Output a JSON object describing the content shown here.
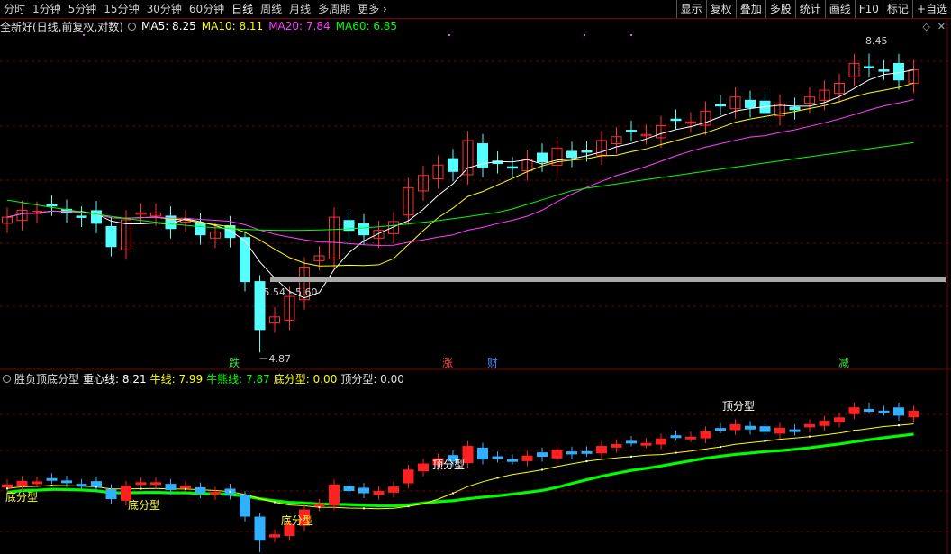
{
  "toolbar": {
    "periods": [
      "分时",
      "1分钟",
      "5分钟",
      "15分钟",
      "30分钟",
      "60分钟",
      "日线",
      "周线",
      "月线",
      "多周期",
      "更多"
    ],
    "active_period": "日线",
    "buttons": [
      "显示",
      "复权",
      "叠加",
      "多股",
      "统计",
      "画线",
      "F10",
      "标记",
      "+自选"
    ]
  },
  "main": {
    "title": "全新好(日线,前复权,对数)",
    "ma5_label": "MA5: 8.25",
    "ma10_label": "MA10: 8.11",
    "ma20_label": "MA20: 7.84",
    "ma60_label": "MA60: 6.85",
    "high_label": "8.45",
    "low_label": "4.87",
    "range_label": "5.54 - 5.60",
    "marks": [
      {
        "text": "跌",
        "color": "#40e040"
      },
      {
        "text": "涨",
        "color": "#ff4040"
      },
      {
        "text": "财",
        "color": "#4080ff"
      },
      {
        "text": "减",
        "color": "#40e040"
      }
    ]
  },
  "sub": {
    "title": "胜负顶底分型",
    "center_label": "重心线: 8.21",
    "bull_label": "牛线: 7.99",
    "bullbear_label": "牛熊线: 7.87",
    "bottom_label": "底分型: 0.00",
    "top_label": "顶分型: 0.00",
    "annotations": [
      "底分型",
      "底分型",
      "底分型",
      "顶分型",
      "顶分型"
    ]
  },
  "colors": {
    "ma5": "#ffffff",
    "ma10": "#ffff00",
    "ma20": "#ff40ff",
    "ma60": "#00ff00",
    "up": "#ff3030",
    "down": "#54ffff",
    "grid": "#7a0000"
  },
  "chart_data": {
    "type": "candlestick",
    "closes": [
      6.25,
      6.33,
      6.32,
      6.38,
      6.3,
      6.25,
      6.18,
      5.92,
      6.22,
      6.3,
      6.3,
      6.12,
      6.22,
      6.05,
      6.08,
      6.02,
      5.55,
      5.08,
      5.2,
      5.4,
      5.7,
      5.82,
      6.25,
      6.1,
      6.05,
      6.1,
      6.2,
      6.6,
      6.75,
      6.88,
      6.8,
      7.2,
      6.85,
      6.9,
      6.85,
      6.95,
      6.92,
      7.1,
      6.98,
      7.05,
      7.2,
      7.25,
      7.32,
      7.28,
      7.4,
      7.48,
      7.45,
      7.6,
      7.68,
      7.8,
      7.65,
      7.58,
      7.7,
      7.62,
      7.8,
      7.9,
      8.0,
      8.3,
      8.25,
      8.2,
      8.05,
      8.2
    ]
  }
}
